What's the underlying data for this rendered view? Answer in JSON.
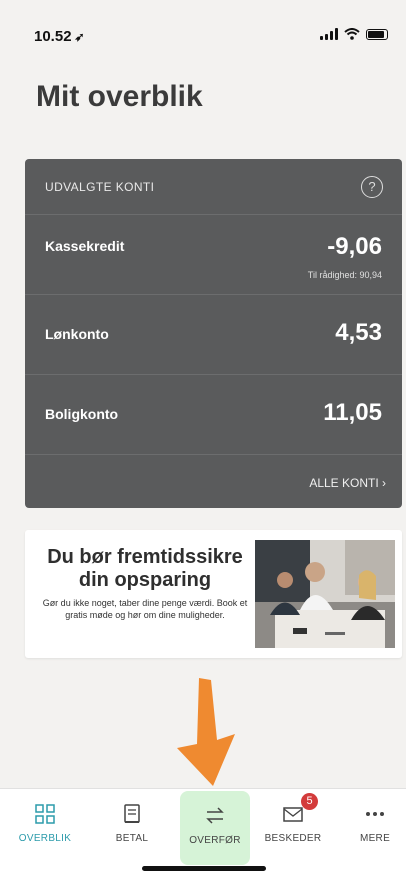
{
  "status": {
    "time": "10.52"
  },
  "page": {
    "title": "Mit overblik"
  },
  "accounts": {
    "header": "UDVALGTE KONTI",
    "help_symbol": "?",
    "rows": [
      {
        "name": "Kassekredit",
        "amount": "-9,06",
        "sub": "Til rådighed: 90,94"
      },
      {
        "name": "Lønkonto",
        "amount": "4,53"
      },
      {
        "name": "Boligkonto",
        "amount": "11,05"
      }
    ],
    "all_link": "ALLE KONTI ›"
  },
  "promo": {
    "title": "Du bør fremtidssikre din opsparing",
    "body": "Gør du ikke noget, taber dine penge værdi. Book et gratis møde og hør om dine muligheder."
  },
  "tabs": [
    {
      "label": "OVERBLIK",
      "icon": "grid-icon"
    },
    {
      "label": "BETAL",
      "icon": "receipt-icon"
    },
    {
      "label": "OVERFØR",
      "icon": "transfer-icon"
    },
    {
      "label": "BESKEDER",
      "icon": "envelope-icon",
      "badge": "5"
    },
    {
      "label": "MERE",
      "icon": "more-icon"
    }
  ],
  "colors": {
    "accent": "#2c9bab",
    "card": "#5a5b5c",
    "arrow": "#ef8a30",
    "highlight": "#d6f3d7",
    "badge": "#d33b3b"
  }
}
